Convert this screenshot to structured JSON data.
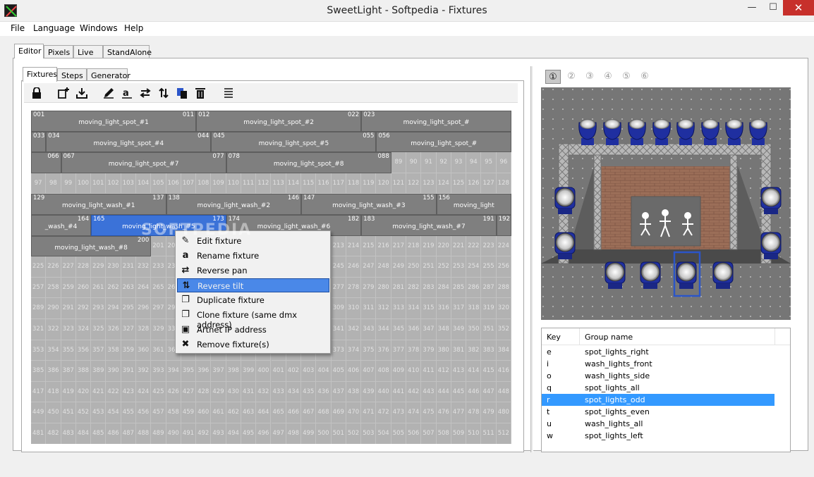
{
  "window": {
    "title": "SweetLight - Softpedia - Fixtures",
    "min": "—",
    "max": "☐",
    "close": "✕"
  },
  "menubar": [
    "File",
    "Language",
    "Windows",
    "Help"
  ],
  "main_tabs": [
    "Editor",
    "Pixels",
    "Live",
    "StandAlone"
  ],
  "sub_tabs": [
    "Fixtures",
    "Steps",
    "Generator"
  ],
  "toolbar_icons": [
    "lock-icon",
    "add-fixture-icon",
    "import-icon",
    "edit-icon",
    "rename-icon",
    "reverse-pan-icon",
    "reverse-tilt-icon",
    "duplicate-icon",
    "delete-icon",
    "list-icon"
  ],
  "fixtures": [
    {
      "start": "001",
      "end": "011",
      "name": "moving_light_spot_#1",
      "row": 0,
      "col": 0,
      "span": 11
    },
    {
      "start": "012",
      "end": "022",
      "name": "moving_light_spot_#2",
      "row": 0,
      "col": 11,
      "span": 11
    },
    {
      "start": "023",
      "end": "",
      "name": "moving_light_spot_#",
      "row": 0,
      "col": 22,
      "span": 10
    },
    {
      "start": "033",
      "end": "",
      "name": "",
      "row": 1,
      "col": 0,
      "span": 1
    },
    {
      "start": "034",
      "end": "044",
      "name": "moving_light_spot_#4",
      "row": 1,
      "col": 1,
      "span": 11
    },
    {
      "start": "045",
      "end": "055",
      "name": "moving_light_spot_#5",
      "row": 1,
      "col": 12,
      "span": 11
    },
    {
      "start": "056",
      "end": "",
      "name": "moving_light_spot_#",
      "row": 1,
      "col": 23,
      "span": 9
    },
    {
      "start": "",
      "end": "066",
      "name": "",
      "row": 2,
      "col": 0,
      "span": 2
    },
    {
      "start": "067",
      "end": "077",
      "name": "moving_light_spot_#7",
      "row": 2,
      "col": 2,
      "span": 11
    },
    {
      "start": "078",
      "end": "088",
      "name": "moving_light_spot_#8",
      "row": 2,
      "col": 13,
      "span": 11
    },
    {
      "start": "129",
      "end": "137",
      "name": "moving_light_wash_#1",
      "row": 4,
      "col": 0,
      "span": 9
    },
    {
      "start": "138",
      "end": "146",
      "name": "moving_light_wash_#2",
      "row": 4,
      "col": 9,
      "span": 9
    },
    {
      "start": "147",
      "end": "155",
      "name": "moving_light_wash_#3",
      "row": 4,
      "col": 18,
      "span": 9
    },
    {
      "start": "156",
      "end": "",
      "name": "moving_light",
      "row": 4,
      "col": 27,
      "span": 5
    },
    {
      "start": "",
      "end": "164",
      "name": "_wash_#4",
      "row": 5,
      "col": 0,
      "span": 4
    },
    {
      "start": "165",
      "end": "173",
      "name": "moving_light_wash_#5",
      "row": 5,
      "col": 4,
      "span": 9,
      "selected": true
    },
    {
      "start": "174",
      "end": "182",
      "name": "moving_light_wash_#6",
      "row": 5,
      "col": 13,
      "span": 9
    },
    {
      "start": "183",
      "end": "191",
      "name": "moving_light_wash_#7",
      "row": 5,
      "col": 22,
      "span": 9
    },
    {
      "start": "192",
      "end": "",
      "name": "",
      "row": 5,
      "col": 31,
      "span": 1
    },
    {
      "start": "",
      "end": "200",
      "name": "moving_light_wash_#8",
      "row": 6,
      "col": 0,
      "span": 8
    }
  ],
  "slots": [
    "①",
    "②",
    "③",
    "④",
    "⑤",
    "⑥"
  ],
  "groups": {
    "header": {
      "key": "Key",
      "name": "Group name"
    },
    "rows": [
      {
        "key": "e",
        "name": "spot_lights_right"
      },
      {
        "key": "i",
        "name": "wash_lights_front"
      },
      {
        "key": "o",
        "name": "wash_lights_side"
      },
      {
        "key": "q",
        "name": "spot_lights_all"
      },
      {
        "key": "r",
        "name": "spot_lights_odd",
        "selected": true
      },
      {
        "key": "t",
        "name": "spot_lights_even"
      },
      {
        "key": "u",
        "name": "wash_lights_all"
      },
      {
        "key": "w",
        "name": "spot_lights_left"
      }
    ]
  },
  "context_menu": [
    {
      "label": "Edit fixture",
      "icon": "edit-icon"
    },
    {
      "label": "Rename fixture",
      "icon": "rename-icon"
    },
    {
      "label": "Reverse pan",
      "icon": "reverse-pan-icon"
    },
    {
      "label": "Reverse tilt",
      "icon": "reverse-tilt-icon",
      "hover": true
    },
    {
      "label": "Duplicate fixture",
      "icon": "duplicate-icon"
    },
    {
      "label": "Clone fixture (same dmx address)",
      "icon": "clone-icon"
    },
    {
      "label": "Artnet IP address",
      "icon": "artnet-icon"
    },
    {
      "label": "Remove fixture(s)",
      "icon": "trash-icon"
    }
  ],
  "watermark": "SOFTPEDIA",
  "colors": {
    "selection": "#3b72d8",
    "fixture": "#7f7f7f",
    "grid": "#b2b2b2",
    "stage_bg": "#777777",
    "fixture_blue": "#1f2fa0"
  }
}
